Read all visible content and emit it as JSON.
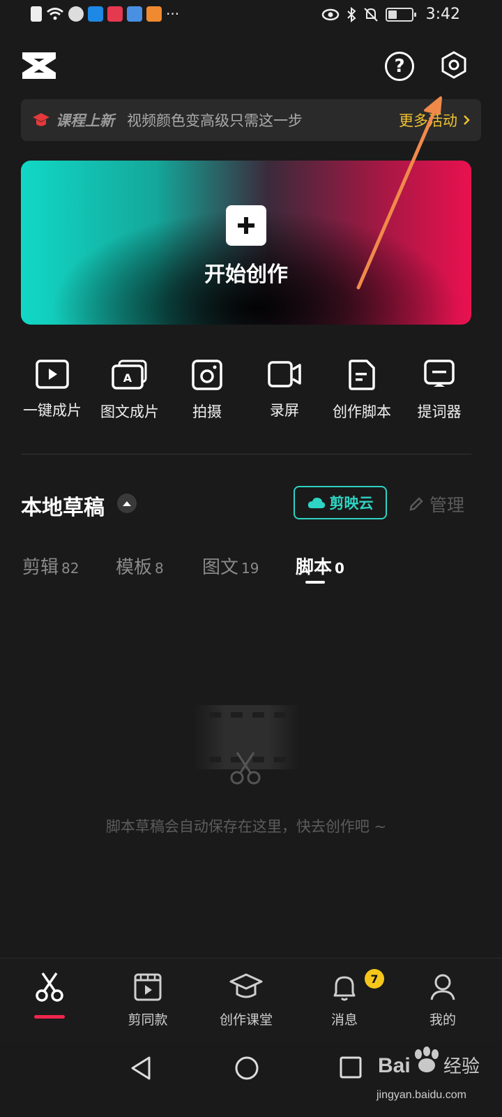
{
  "status_bar": {
    "time": "3:42",
    "left_icons": [
      "alert-icon",
      "wifi-icon",
      "app-icon",
      "app-icon",
      "app-icon",
      "app-icon",
      "app-icon"
    ],
    "more": "···",
    "right_icons": [
      "eye-icon",
      "bluetooth-icon",
      "mute-icon",
      "battery-icon"
    ]
  },
  "header": {
    "logo": "capcut-logo",
    "help_label": "?",
    "settings_icon": "gear-icon"
  },
  "banner": {
    "tag": "课程上新",
    "message": "视频颜色变高级只需这一步",
    "more": "更多活动"
  },
  "create": {
    "label": "开始创作"
  },
  "tools": [
    {
      "label": "一键成片",
      "icon": "play-icon"
    },
    {
      "label": "图文成片",
      "icon": "text-to-video-icon"
    },
    {
      "label": "拍摄",
      "icon": "camera-icon"
    },
    {
      "label": "录屏",
      "icon": "screen-record-icon"
    },
    {
      "label": "创作脚本",
      "icon": "script-icon"
    },
    {
      "label": "提词器",
      "icon": "teleprompter-icon"
    }
  ],
  "drafts": {
    "title": "本地草稿",
    "cloud_label": "剪映云",
    "manage_label": "管理",
    "tabs": [
      {
        "label": "剪辑",
        "count": "82",
        "active": false
      },
      {
        "label": "模板",
        "count": "8",
        "active": false
      },
      {
        "label": "图文",
        "count": "19",
        "active": false
      },
      {
        "label": "脚本",
        "count": "0",
        "active": true
      }
    ],
    "empty_text": "脚本草稿会自动保存在这里，快去创作吧 ~"
  },
  "bottom_nav": [
    {
      "label": "",
      "icon": "scissors-icon",
      "active": true
    },
    {
      "label": "剪同款",
      "icon": "template-icon",
      "active": false
    },
    {
      "label": "创作课堂",
      "icon": "graduation-cap-icon",
      "active": false
    },
    {
      "label": "消息",
      "icon": "bell-icon",
      "active": false,
      "badge": "7"
    },
    {
      "label": "我的",
      "icon": "user-icon",
      "active": false
    }
  ],
  "watermark": {
    "text": "Bai 经验",
    "url": "jingyan.baidu.com"
  },
  "colors": {
    "background": "#1a1a1a",
    "accent_cyan": "#2ed3c3",
    "accent_yellow": "#f2c230",
    "accent_red": "#f0264c",
    "annotation_arrow": "#f08a4b"
  }
}
